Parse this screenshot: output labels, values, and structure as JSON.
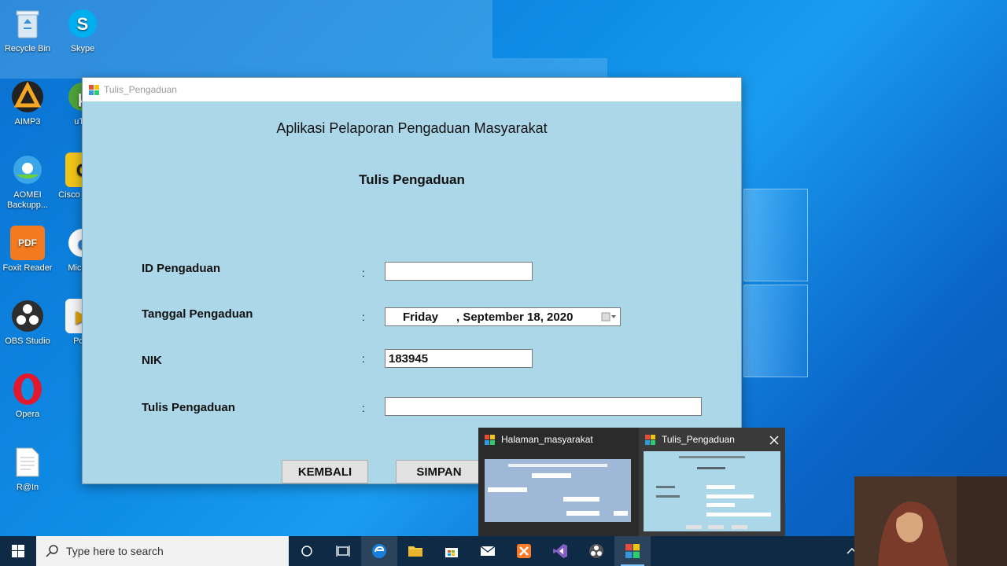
{
  "desktop": {
    "icons": [
      {
        "label": "Recycle Bin"
      },
      {
        "label": "Skype"
      },
      {
        "label": "AIMP3"
      },
      {
        "label": "uTor"
      },
      {
        "label": "AOMEI Backupp..."
      },
      {
        "label": "Cisco Tracer"
      },
      {
        "label": "Foxit Reader"
      },
      {
        "label": "Micr Ed"
      },
      {
        "label": "OBS Studio"
      },
      {
        "label": "PotP"
      },
      {
        "label": "Opera"
      },
      {
        "label": "R@In"
      }
    ]
  },
  "app": {
    "window_title": "Tulis_Pengaduan",
    "heading": "Aplikasi Pelaporan Pengaduan Masyarakat",
    "subheading": "Tulis Pengaduan",
    "colon": ":",
    "fields": {
      "id_label": "ID Pengaduan",
      "id_value": "",
      "tanggal_label": "Tanggal Pengaduan",
      "tanggal_day": "Friday",
      "tanggal_date": ", September 18, 2020",
      "nik_label": "NIK",
      "nik_value": "183945",
      "tulis_label": "Tulis Pengaduan",
      "tulis_value": ""
    },
    "buttons": {
      "back": "KEMBALI",
      "save": "SIMPAN"
    }
  },
  "preview": {
    "items": [
      {
        "title": "Halaman_masyarakat"
      },
      {
        "title": "Tulis_Pengaduan"
      }
    ]
  },
  "taskbar": {
    "search_placeholder": "Type here to search"
  },
  "colors": {
    "app_bg": "#acd7e8",
    "taskbar_bg": "#0e2a45",
    "desktop_blue": "#0f8ee6"
  }
}
